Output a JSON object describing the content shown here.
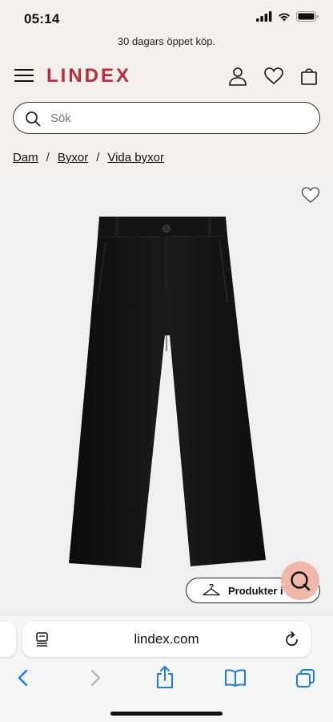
{
  "status": {
    "time": "05:14"
  },
  "promo": {
    "text": "30 dagars öppet köp."
  },
  "header": {
    "logo": "LINDEX"
  },
  "search": {
    "placeholder": "Sök",
    "value": ""
  },
  "breadcrumb": [
    {
      "label": "Dam"
    },
    {
      "label": "Byxor"
    },
    {
      "label": "Vida byxor"
    }
  ],
  "breadcrumb_separator": "/",
  "product": {
    "products_button_label": "Produkter i b"
  },
  "browser": {
    "url": "lindex.com"
  },
  "colors": {
    "brand": "#c0283b",
    "chat": "#f0b8a8",
    "safari_blue": "#1a7cf5"
  }
}
